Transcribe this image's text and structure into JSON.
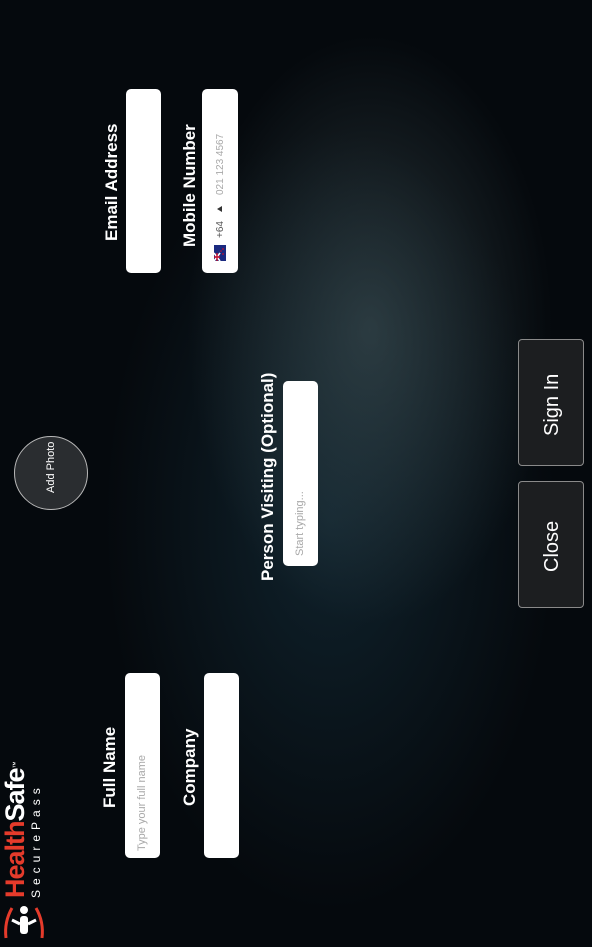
{
  "brand": {
    "name_part1": "Health",
    "name_part2": "Safe",
    "trademark": "™",
    "tagline": "SecurePass"
  },
  "photo": {
    "label": "Add Photo"
  },
  "form": {
    "full_name": {
      "label": "Full Name",
      "placeholder": "Type your full name"
    },
    "company": {
      "label": "Company",
      "placeholder": ""
    },
    "person_visiting": {
      "label": "Person Visiting (Optional)",
      "placeholder": "Start typing..."
    },
    "email": {
      "label": "Email Address",
      "placeholder": ""
    },
    "mobile": {
      "label": "Mobile Number",
      "country_code": "+64",
      "placeholder": "021 123 4567"
    }
  },
  "buttons": {
    "close": "Close",
    "sign_in": "Sign In"
  }
}
